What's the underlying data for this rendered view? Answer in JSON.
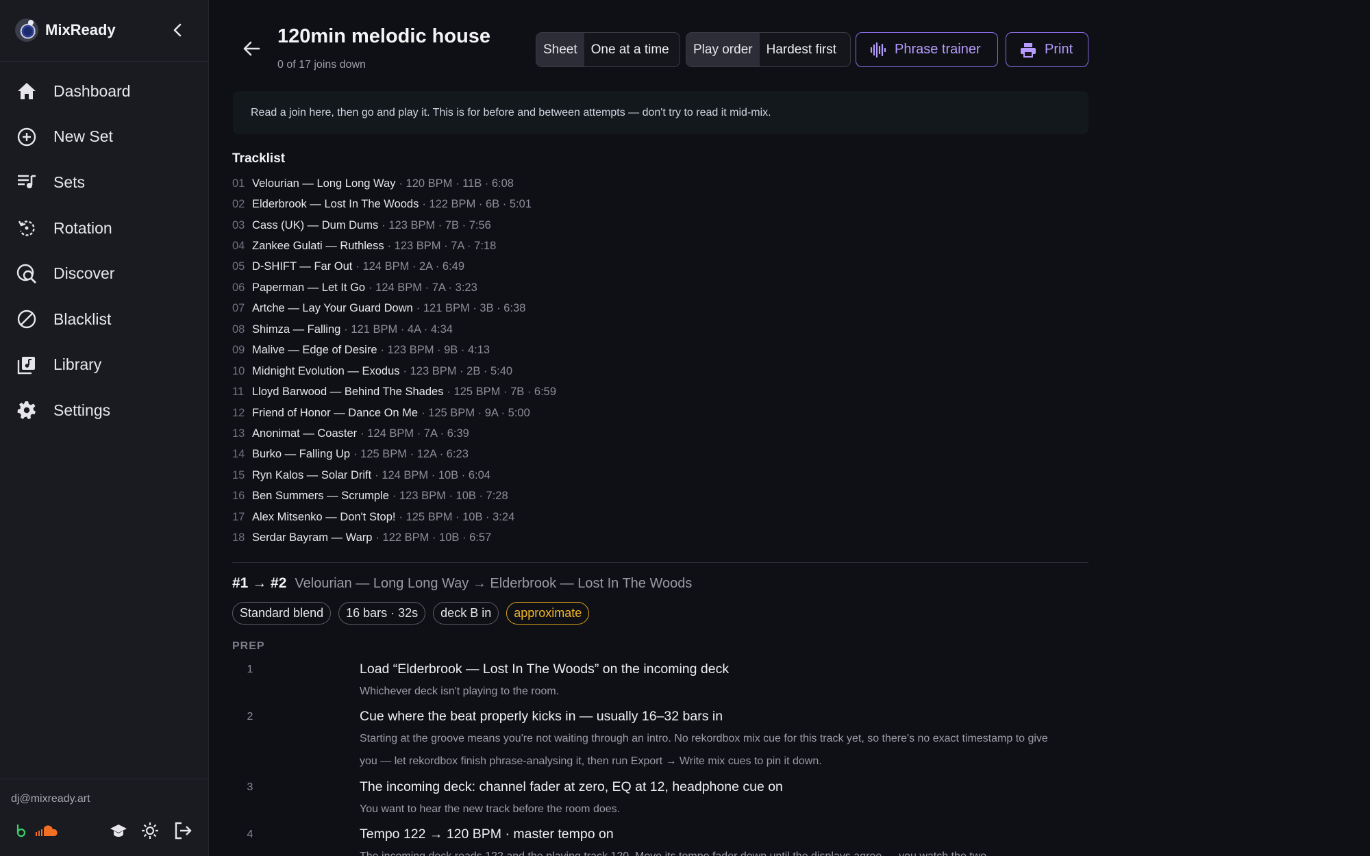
{
  "app": {
    "name": "MixReady",
    "user_email": "dj@mixready.art"
  },
  "sidebar": {
    "items": [
      {
        "label": "Dashboard",
        "icon": "home-icon"
      },
      {
        "label": "New Set",
        "icon": "plus-circle-icon"
      },
      {
        "label": "Sets",
        "icon": "playlist-icon"
      },
      {
        "label": "Rotation",
        "icon": "rotate-icon"
      },
      {
        "label": "Discover",
        "icon": "discover-search-icon"
      },
      {
        "label": "Blacklist",
        "icon": "block-icon"
      },
      {
        "label": "Library",
        "icon": "music-library-icon"
      },
      {
        "label": "Settings",
        "icon": "gear-icon"
      }
    ]
  },
  "header": {
    "title": "120min melodic house",
    "subtitle": "0 of 17 joins down",
    "view_toggle": [
      "Sheet",
      "One at a time"
    ],
    "order_toggle": [
      "Play order",
      "Hardest first"
    ],
    "phrase_trainer": "Phrase trainer",
    "print": "Print"
  },
  "notice": "Read a join here, then go and play it. This is for before and between attempts — don't try to read it mid-mix.",
  "tracklist": {
    "title": "Tracklist",
    "tracks": [
      {
        "num": "01",
        "name": "Velourian — Long Long Way",
        "meta": "· 120 BPM · 11B · 6:08"
      },
      {
        "num": "02",
        "name": "Elderbrook — Lost In The Woods",
        "meta": "· 122 BPM · 6B · 5:01"
      },
      {
        "num": "03",
        "name": "Cass (UK) — Dum Dums",
        "meta": "· 123 BPM · 7B · 7:56"
      },
      {
        "num": "04",
        "name": "Zankee Gulati — Ruthless",
        "meta": "· 123 BPM · 7A · 7:18"
      },
      {
        "num": "05",
        "name": "D-SHIFT — Far Out",
        "meta": "· 124 BPM · 2A · 6:49"
      },
      {
        "num": "06",
        "name": "Paperman — Let It Go",
        "meta": "· 124 BPM · 7A · 3:23"
      },
      {
        "num": "07",
        "name": "Artche — Lay Your Guard Down",
        "meta": "· 121 BPM · 3B · 6:38"
      },
      {
        "num": "08",
        "name": "Shimza — Falling",
        "meta": "· 121 BPM · 4A · 4:34"
      },
      {
        "num": "09",
        "name": "Malive — Edge of Desire",
        "meta": "· 123 BPM · 9B · 4:13"
      },
      {
        "num": "10",
        "name": "Midnight Evolution — Exodus",
        "meta": "· 123 BPM · 2B · 5:40"
      },
      {
        "num": "11",
        "name": "Lloyd Barwood — Behind The Shades",
        "meta": "· 125 BPM · 7B · 6:59"
      },
      {
        "num": "12",
        "name": "Friend of Honor — Dance On Me",
        "meta": "· 125 BPM · 9A · 5:00"
      },
      {
        "num": "13",
        "name": "Anonimat — Coaster",
        "meta": "· 124 BPM · 7A · 6:39"
      },
      {
        "num": "14",
        "name": "Burko — Falling Up",
        "meta": "· 125 BPM · 12A · 6:23"
      },
      {
        "num": "15",
        "name": "Ryn Kalos — Solar Drift",
        "meta": "· 124 BPM · 10B · 6:04"
      },
      {
        "num": "16",
        "name": "Ben Summers — Scrumple",
        "meta": "· 123 BPM · 10B · 7:28"
      },
      {
        "num": "17",
        "name": "Alex Mitsenko — Don't Stop!",
        "meta": "· 125 BPM · 10B · 3:24"
      },
      {
        "num": "18",
        "name": "Serdar Bayram — Warp",
        "meta": "· 122 BPM · 10B · 6:57"
      }
    ]
  },
  "transition": {
    "label": "#1 → #2",
    "description": "Velourian — Long Long Way → Elderbrook — Lost In The Woods",
    "chips": [
      "Standard blend",
      "16 bars · 32s",
      "deck B in",
      "approximate"
    ],
    "section": "PREP",
    "steps": [
      {
        "n": "1",
        "title": "Load “Elderbrook — Lost In The Woods” on the incoming deck",
        "desc": "Whichever deck isn't playing to the room."
      },
      {
        "n": "2",
        "title": "Cue where the beat properly kicks in — usually 16–32 bars in",
        "desc": "Starting at the groove means you're not waiting through an intro. No rekordbox mix cue for this track yet, so there's no exact timestamp to give you — let rekordbox finish phrase-analysing it, then run Export → Write mix cues to pin it down."
      },
      {
        "n": "3",
        "title": "The incoming deck: channel fader at zero, EQ at 12, headphone cue on",
        "desc": "You want to hear the new track before the room does."
      },
      {
        "n": "4",
        "title": "Tempo 122 → 120 BPM · master tempo on",
        "desc": "The incoming deck reads 122 and the playing track 120. Move its tempo fader down until the displays agree — you watch the two"
      }
    ]
  },
  "colors": {
    "accent": "#8b6de6",
    "warning": "#f1b52a",
    "background": "#0f1015",
    "sidebar": "#1a1b21"
  }
}
